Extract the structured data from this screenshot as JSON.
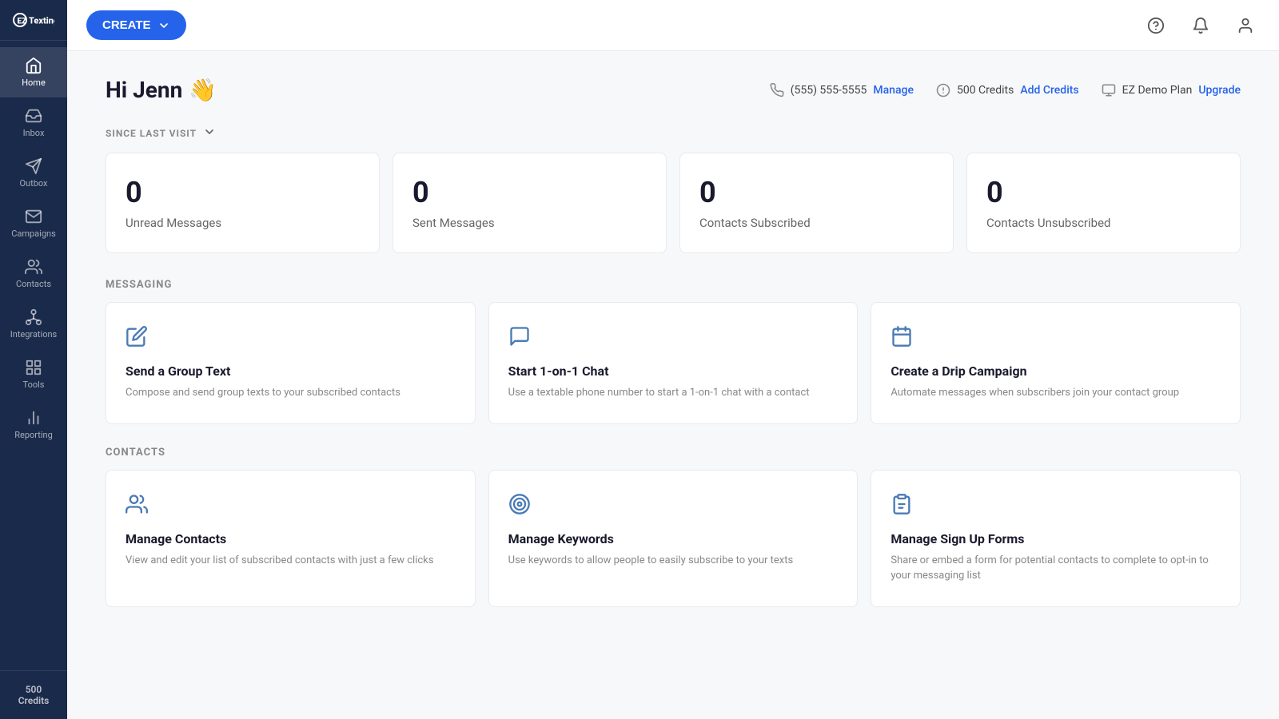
{
  "sidebar": {
    "logo_text": "EZTexting",
    "credits_label": "500",
    "credits_sublabel": "Credits",
    "nav_items": [
      {
        "id": "home",
        "label": "Home",
        "active": true
      },
      {
        "id": "inbox",
        "label": "Inbox",
        "active": false
      },
      {
        "id": "outbox",
        "label": "Outbox",
        "active": false
      },
      {
        "id": "campaigns",
        "label": "Campaigns",
        "active": false
      },
      {
        "id": "contacts",
        "label": "Contacts",
        "active": false
      },
      {
        "id": "integrations",
        "label": "Integrations",
        "active": false
      },
      {
        "id": "tools",
        "label": "Tools",
        "active": false
      },
      {
        "id": "reporting",
        "label": "Reporting",
        "active": false
      }
    ]
  },
  "topbar": {
    "create_label": "CREATE"
  },
  "header": {
    "greeting": "Hi Jenn",
    "wave_emoji": "👋",
    "phone": "(555) 555-5555",
    "manage_label": "Manage",
    "credits": "500 Credits",
    "add_credits_label": "Add Credits",
    "plan": "EZ Demo Plan",
    "upgrade_label": "Upgrade"
  },
  "since_last_visit": {
    "label": "SINCE LAST VISIT",
    "stats": [
      {
        "value": "0",
        "label": "Unread Messages"
      },
      {
        "value": "0",
        "label": "Sent Messages"
      },
      {
        "value": "0",
        "label": "Contacts Subscribed"
      },
      {
        "value": "0",
        "label": "Contacts Unsubscribed"
      }
    ]
  },
  "messaging": {
    "section_label": "MESSAGING",
    "cards": [
      {
        "title": "Send a Group Text",
        "desc": "Compose and send group texts to your subscribed contacts"
      },
      {
        "title": "Start 1-on-1 Chat",
        "desc": "Use a textable phone number to start a 1-on-1 chat with a contact"
      },
      {
        "title": "Create a Drip Campaign",
        "desc": "Automate messages when subscribers join your contact group"
      }
    ]
  },
  "contacts": {
    "section_label": "CONTACTS",
    "cards": [
      {
        "title": "Manage Contacts",
        "desc": "View and edit your list of subscribed contacts with just a few clicks"
      },
      {
        "title": "Manage Keywords",
        "desc": "Use keywords to allow people to easily subscribe to your texts"
      },
      {
        "title": "Manage Sign Up Forms",
        "desc": "Share or embed a form for potential contacts to complete to opt-in to your messaging list"
      }
    ]
  }
}
